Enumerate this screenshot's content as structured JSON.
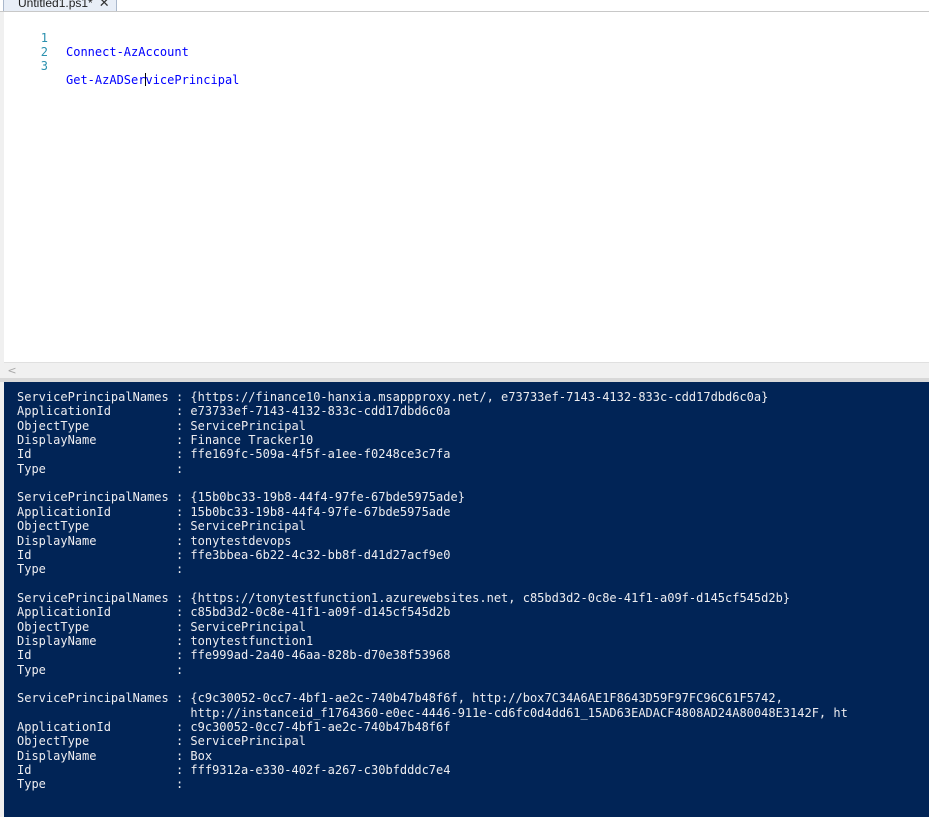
{
  "tab": {
    "title": "Untitled1.ps1*",
    "close_glyph": "✕"
  },
  "editor": {
    "lines": [
      {
        "number": "1",
        "code": "Connect-AzAccount"
      },
      {
        "number": "2",
        "code": ""
      },
      {
        "number": "3",
        "code_before_caret": "Get-AzADSer",
        "code_after_caret": "vicePrincipal"
      }
    ]
  },
  "scrollbar": {
    "left_arrow": "<"
  },
  "console": {
    "lines": [
      "ServicePrincipalNames : {https://finance10-hanxia.msappproxy.net/, e73733ef-7143-4132-833c-cdd17dbd6c0a}",
      "ApplicationId         : e73733ef-7143-4132-833c-cdd17dbd6c0a",
      "ObjectType            : ServicePrincipal",
      "DisplayName           : Finance Tracker10",
      "Id                    : ffe169fc-509a-4f5f-a1ee-f0248ce3c7fa",
      "Type                  :",
      "",
      "ServicePrincipalNames : {15b0bc33-19b8-44f4-97fe-67bde5975ade}",
      "ApplicationId         : 15b0bc33-19b8-44f4-97fe-67bde5975ade",
      "ObjectType            : ServicePrincipal",
      "DisplayName           : tonytestdevops",
      "Id                    : ffe3bbea-6b22-4c32-bb8f-d41d27acf9e0",
      "Type                  :",
      "",
      "ServicePrincipalNames : {https://tonytestfunction1.azurewebsites.net, c85bd3d2-0c8e-41f1-a09f-d145cf545d2b}",
      "ApplicationId         : c85bd3d2-0c8e-41f1-a09f-d145cf545d2b",
      "ObjectType            : ServicePrincipal",
      "DisplayName           : tonytestfunction1",
      "Id                    : ffe999ad-2a40-46aa-828b-d70e38f53968",
      "Type                  :",
      "",
      "ServicePrincipalNames : {c9c30052-0cc7-4bf1-ae2c-740b47b48f6f, http://box7C34A6AE1F8643D59F97FC96C61F5742,",
      "                        http://instanceid_f1764360-e0ec-4446-911e-cd6fc0d4dd61_15AD63EADACF4808AD24A80048E3142F, ht",
      "ApplicationId         : c9c30052-0cc7-4bf1-ae2c-740b47b48f6f",
      "ObjectType            : ServicePrincipal",
      "DisplayName           : Box",
      "Id                    : fff9312a-e330-402f-a267-c30bfdddc7e4",
      "Type                  :"
    ]
  },
  "colors": {
    "console_background": "#012456",
    "console_text": "#eeedf0",
    "line_number": "#2b91af",
    "command": "#0000ff"
  }
}
